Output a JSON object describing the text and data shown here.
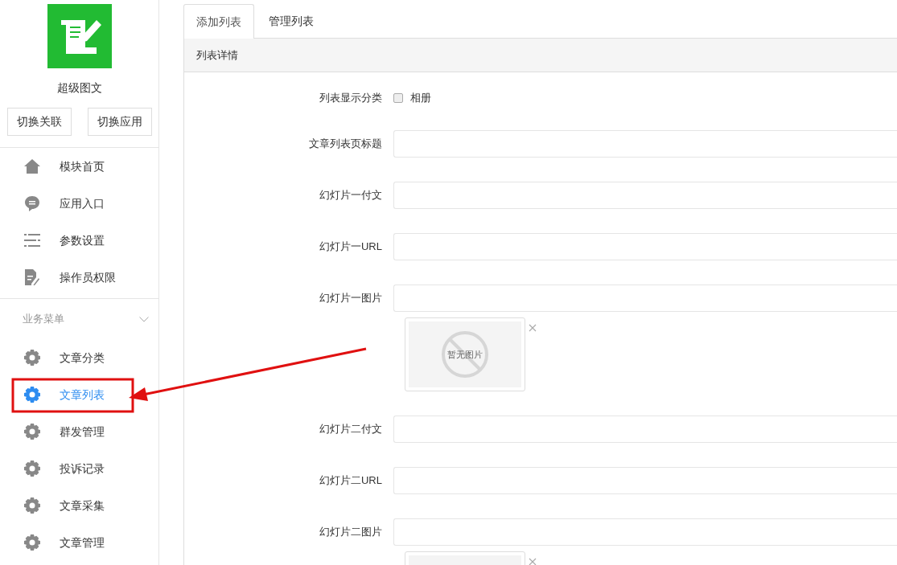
{
  "app": {
    "name": "超级图文",
    "buttons": [
      "切换关联",
      "切换应用"
    ]
  },
  "nav": [
    {
      "label": "模块首页",
      "selected": false
    },
    {
      "label": "应用入口",
      "selected": false
    },
    {
      "label": "参数设置",
      "selected": false
    },
    {
      "label": "操作员权限",
      "selected": false
    }
  ],
  "business_menu": {
    "title": "业务菜单",
    "expanded": true,
    "items": [
      {
        "label": "文章分类",
        "selected": false
      },
      {
        "label": "文章列表",
        "selected": true
      },
      {
        "label": "群发管理",
        "selected": false
      },
      {
        "label": "投诉记录",
        "selected": false
      },
      {
        "label": "文章采集",
        "selected": false
      },
      {
        "label": "文章管理",
        "selected": false
      }
    ]
  },
  "tabs": [
    {
      "label": "添加列表",
      "selected": true
    },
    {
      "label": "管理列表",
      "selected": false
    }
  ],
  "panel": {
    "title": "列表详情",
    "fields": [
      {
        "kind": "checkbox",
        "label": "列表显示分类",
        "option": "相册",
        "checked": false
      },
      {
        "kind": "text",
        "label": "文章列表页标题"
      },
      {
        "kind": "text",
        "label": "幻灯片一付文"
      },
      {
        "kind": "text",
        "label": "幻灯片一URL"
      },
      {
        "kind": "image",
        "label": "幻灯片一图片",
        "preview_text": "暂无图片"
      },
      {
        "kind": "text",
        "label": "幻灯片二付文"
      },
      {
        "kind": "text",
        "label": "幻灯片二URL"
      },
      {
        "kind": "image",
        "label": "幻灯片二图片"
      }
    ]
  }
}
